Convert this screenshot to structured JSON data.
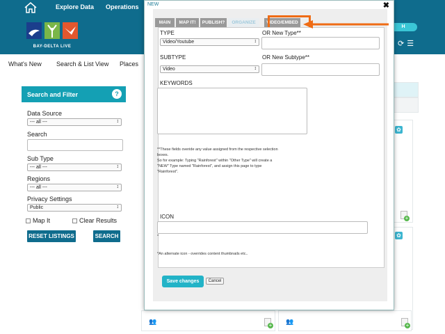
{
  "nav": {
    "explore": "Explore Data",
    "operations": "Operations"
  },
  "logo": {
    "text": "BAY-DELTA LIVE"
  },
  "banner": {
    "button_label": "H"
  },
  "subnav": {
    "whats_new": "What's New",
    "search_list": "Search & List View",
    "places": "Places"
  },
  "filter": {
    "title": "Search and Filter",
    "help": "?",
    "data_source_label": "Data Source",
    "data_source_value": "--- all ---",
    "search_label": "Search",
    "sub_type_label": "Sub Type",
    "sub_type_value": "--- all ---",
    "regions_label": "Regions",
    "regions_value": "--- all ---",
    "privacy_label": "Privacy Settings",
    "privacy_value": "Public",
    "map_it": "Map It",
    "clear_results": "Clear Results",
    "reset_button": "RESET LISTINGS",
    "search_button": "SEARCH"
  },
  "modal": {
    "title": "NEW",
    "close": "✖",
    "tabs": {
      "main": "MAIN",
      "map_it": "MAP IT!",
      "publish": "PUBLISH?",
      "organize": "ORGANIZE",
      "video_embed": "VIDEO/EMBED"
    },
    "type_label": "TYPE",
    "type_value": "Video/Youtube",
    "new_type_label": "OR New Type**",
    "subtype_label": "SUBTYPE",
    "subtype_value": "Video",
    "new_subtype_label": "OR New Subtype**",
    "keywords_label": "KEYWORDS",
    "note_lines": [
      "**These fields overide any value assigned from the respective selection",
      "boxes.",
      "So for example: Typing \"Rainforest\" within \"Other Type\" will create a",
      "\"NEW\" Type named \"Rainforest\", and assign this page to type",
      "\"Rainforest\"."
    ],
    "icon_label": "ICON",
    "icon_asterisk": "*",
    "icon_note": "*An alternate icon - overrides content thumbnails etc..",
    "save_button": "Save changes",
    "cancel_button": "Cancel"
  },
  "colors": {
    "header": "#0f6c8d",
    "accent": "#14a0b4",
    "highlight": "#ef6c15"
  }
}
